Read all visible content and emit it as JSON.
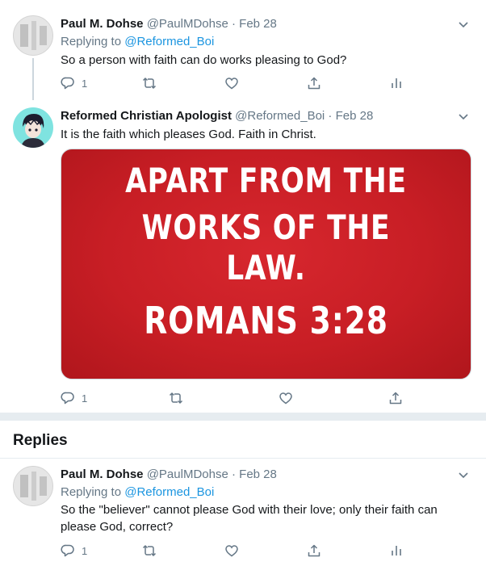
{
  "tweets": [
    {
      "name": "Paul M. Dohse",
      "handle": "@PaulMDohse",
      "dot": "·",
      "date": "Feb 28",
      "replying_prefix": "Replying to",
      "replying_to": "@Reformed_Boi",
      "text": "So a person with faith can do works pleasing to God?",
      "reply_count": "1"
    },
    {
      "name": "Reformed Christian Apologist",
      "handle": "@Reformed_Boi",
      "dot": "·",
      "date": "Feb 28",
      "text": "It is the faith which pleases God. Faith in Christ.",
      "image_lines": [
        "APART FROM THE",
        "WORKS OF THE LAW.",
        "ROMANS 3:28"
      ],
      "reply_count": "1"
    },
    {
      "name": "Paul M. Dohse",
      "handle": "@PaulMDohse",
      "dot": "·",
      "date": "Feb 28",
      "replying_prefix": "Replying to",
      "replying_to": "@Reformed_Boi",
      "text": "So the \"believer\" cannot please God with their love; only their faith can please God, correct?",
      "reply_count": "1"
    }
  ],
  "section": {
    "replies_title": "Replies"
  },
  "colors": {
    "accent": "#1b95e0",
    "muted": "#657786",
    "image_red": "#c81e25",
    "separator": "#e6ecf0"
  },
  "icons": [
    "reply-icon",
    "retweet-icon",
    "like-icon",
    "share-icon",
    "analytics-icon",
    "chevron-down-icon"
  ]
}
